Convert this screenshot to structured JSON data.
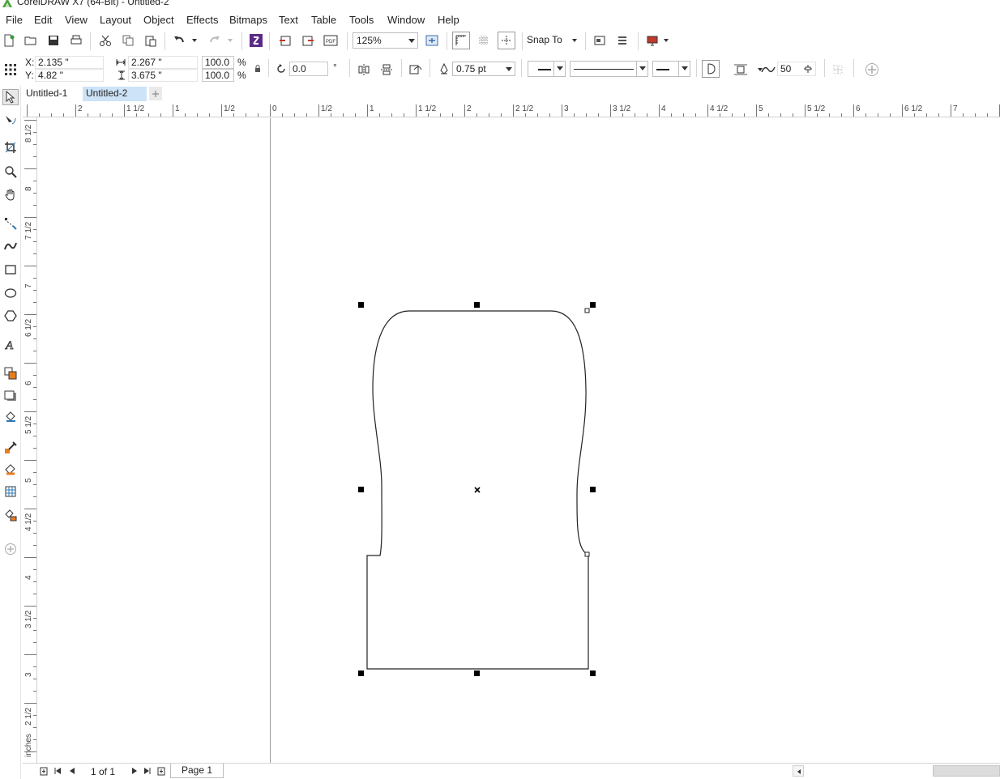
{
  "window": {
    "title": "CorelDRAW X7 (64-Bit) - Untitled-2"
  },
  "menu": [
    "File",
    "Edit",
    "View",
    "Layout",
    "Object",
    "Effects",
    "Bitmaps",
    "Text",
    "Table",
    "Tools",
    "Window",
    "Help"
  ],
  "toolbar": {
    "zoom_value": "125%",
    "snap_to_label": "Snap To"
  },
  "propbar": {
    "x_label": "X:",
    "x_value": "2.135 \"",
    "y_label": "Y:",
    "y_value": "4.82 \"",
    "width_value": "2.267 \"",
    "height_value": "3.675 \"",
    "scale_x": "100.0",
    "scale_y": "100.0",
    "percent": "%",
    "rotation": "0.0",
    "degree": "°",
    "outline_width": "0.75 pt",
    "smoothing": "50"
  },
  "tabs": [
    "Untitled-1",
    "Untitled-2"
  ],
  "active_tab": "Untitled-2",
  "rulers": {
    "units": "inches",
    "horizontal_labels": [
      "2",
      "1 1/2",
      "1",
      "1/2",
      "0",
      "1/2",
      "1",
      "1 1/2",
      "2",
      "2 1/2",
      "3",
      "3 1/2",
      "4",
      "4 1/2",
      "5",
      "5 1/2",
      "6",
      "6 1/2",
      "7"
    ],
    "vertical_labels": [
      "8 1/2",
      "8",
      "7 1/2",
      "7",
      "6 1/2",
      "6",
      "5 1/2",
      "5",
      "4 1/2",
      "4",
      "3 1/2",
      "3",
      "2 1/2",
      "inches"
    ]
  },
  "pagenav": {
    "page_count": "1 of 1",
    "page_tab": "Page 1"
  },
  "colors": {
    "accent_tab": "#cde3f7",
    "outline": "#222222",
    "handle": "#000000"
  }
}
